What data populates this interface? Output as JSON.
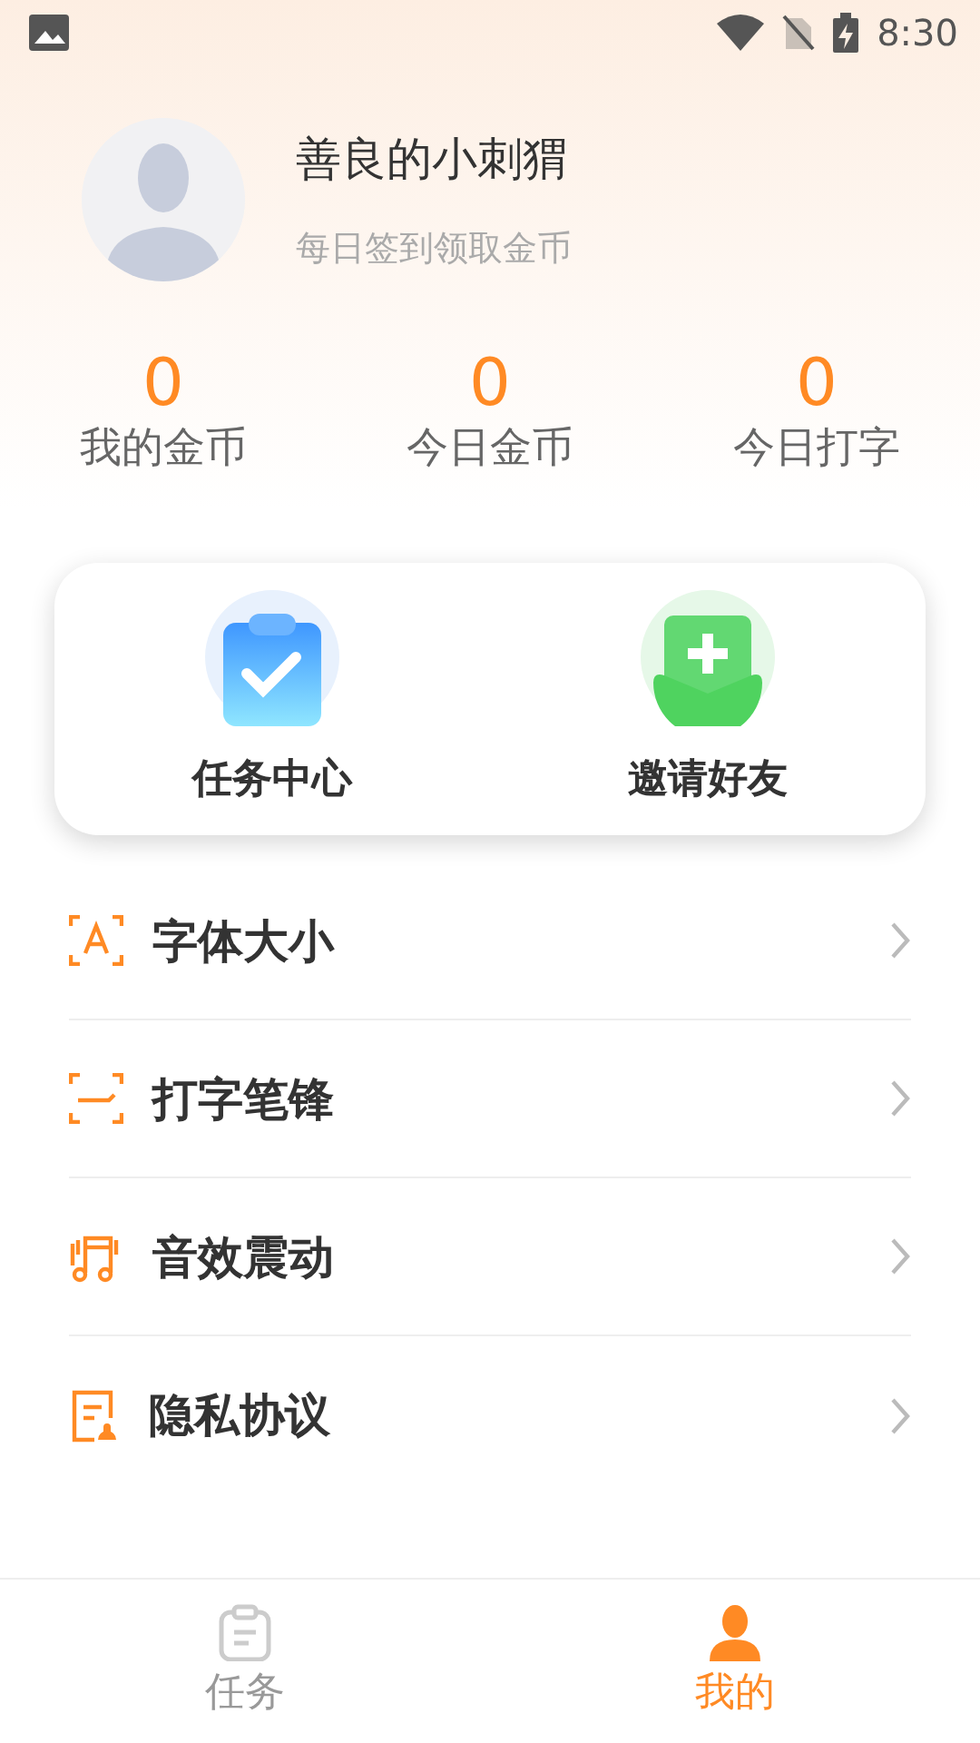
{
  "status_bar": {
    "time": "8:30"
  },
  "profile": {
    "name": "善良的小刺猬",
    "subtitle": "每日签到领取金币"
  },
  "stats": [
    {
      "value": "0",
      "label": "我的金币"
    },
    {
      "value": "0",
      "label": "今日金币"
    },
    {
      "value": "0",
      "label": "今日打字"
    }
  ],
  "shortcuts": [
    {
      "kind": "tasks",
      "label": "任务中心"
    },
    {
      "kind": "invite",
      "label": "邀请好友"
    }
  ],
  "menu": [
    {
      "kind": "font",
      "label": "字体大小"
    },
    {
      "kind": "pen",
      "label": "打字笔锋"
    },
    {
      "kind": "sound",
      "label": "音效震动"
    },
    {
      "kind": "privacy",
      "label": "隐私协议"
    }
  ],
  "tabs": [
    {
      "kind": "tasks",
      "label": "任务",
      "selected": false
    },
    {
      "kind": "me",
      "label": "我的",
      "selected": true
    }
  ]
}
